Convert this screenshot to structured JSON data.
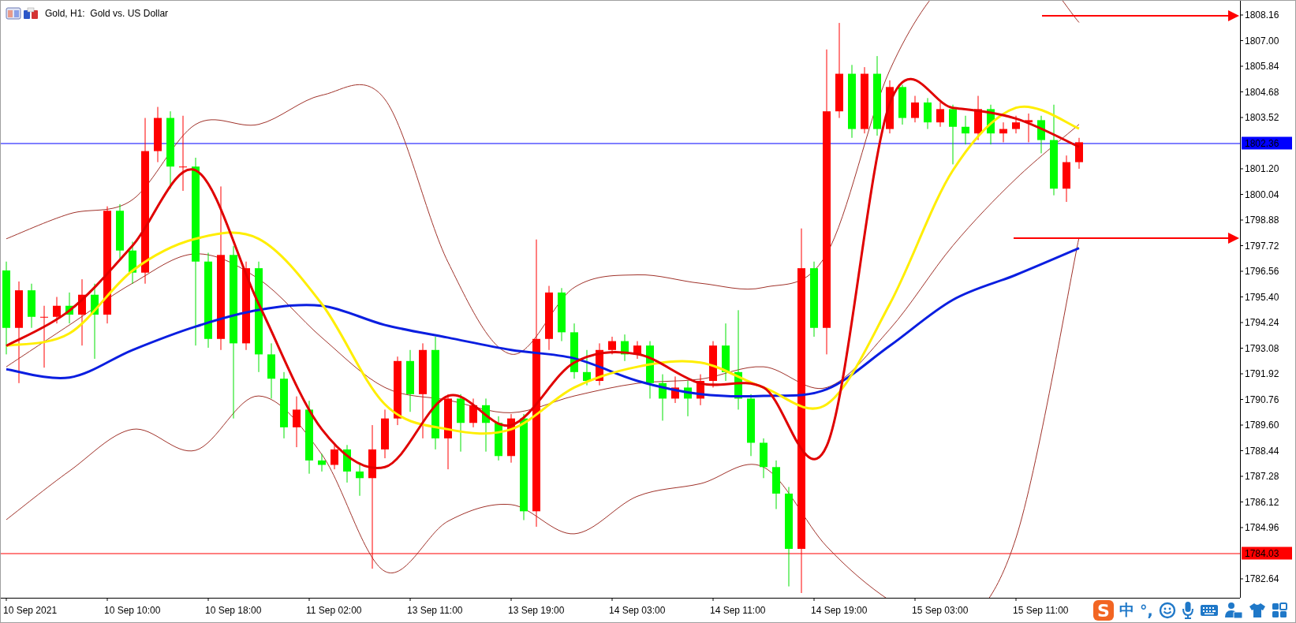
{
  "window": {
    "title": "Gold, H1:  Gold vs. US Dollar"
  },
  "price_axis": [
    {
      "label": "1808.16"
    },
    {
      "label": "1807.00"
    },
    {
      "label": "1805.84"
    },
    {
      "label": "1804.68"
    },
    {
      "label": "1803.52"
    },
    {
      "label": "1802.36",
      "color": "#0000ff"
    },
    {
      "label": "1801.20"
    },
    {
      "label": "1800.04"
    },
    {
      "label": "1798.88"
    },
    {
      "label": "1797.72"
    },
    {
      "label": "1796.56"
    },
    {
      "label": "1795.40"
    },
    {
      "label": "1794.24"
    },
    {
      "label": "1793.08"
    },
    {
      "label": "1791.92"
    },
    {
      "label": "1790.76"
    },
    {
      "label": "1789.60"
    },
    {
      "label": "1788.44"
    },
    {
      "label": "1787.28"
    },
    {
      "label": "1786.12"
    },
    {
      "label": "1784.96"
    },
    {
      "label": "1784.03",
      "color": "#ff0000"
    },
    {
      "label": "1782.64"
    }
  ],
  "time_axis": [
    "10 Sep 2021",
    "10 Sep 10:00",
    "10 Sep 18:00",
    "11 Sep 02:00",
    "13 Sep 11:00",
    "13 Sep 19:00",
    "14 Sep 03:00",
    "14 Sep 11:00",
    "14 Sep 19:00",
    "15 Sep 03:00",
    "15 Sep 11:00"
  ],
  "input_method_bar": {
    "logo": "S",
    "items": [
      "中",
      "°,"
    ]
  }
}
